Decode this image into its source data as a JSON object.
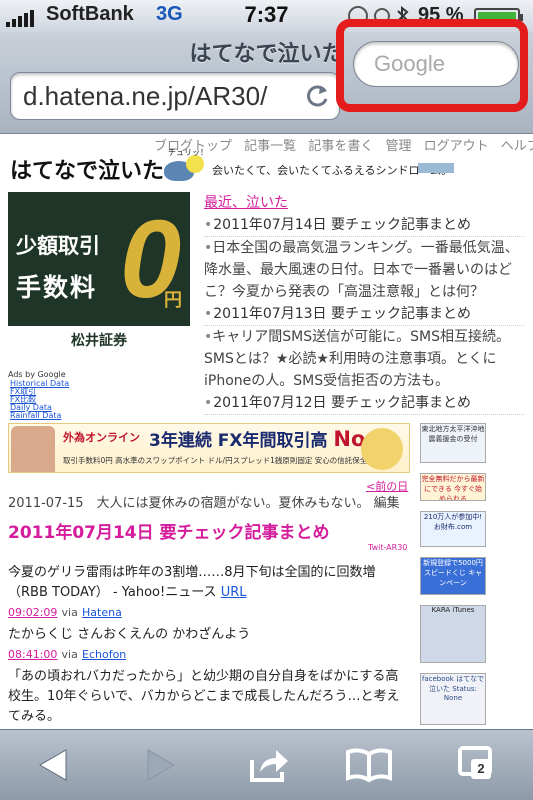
{
  "status_bar": {
    "carrier": "SoftBank",
    "network": "3G",
    "time": "7:37",
    "battery_percent": "95 %"
  },
  "browser": {
    "page_title": "はてなで泣いた",
    "url": "d.hatena.ne.jp/AR30/",
    "search_placeholder": "Google",
    "tab_count": "2"
  },
  "page": {
    "nav_links": [
      "ブログトップ",
      "記事一覧",
      "記事を書く",
      "管理",
      "ログアウト",
      "ヘルプ"
    ],
    "bird_tag": "チュリッ！",
    "blog_title": "はてなで泣いた",
    "tagline": "会いたくて、会いたくてふるえるシンドローム。",
    "ad_top": {
      "line1": "少額取引",
      "line2": "手数料",
      "zero": "0",
      "yen": "円",
      "brand": "松井証券"
    },
    "ads_by": "Ads by Google",
    "ad_links": [
      "Historical Data",
      "FX取引",
      "FX比較",
      "Daily Data",
      "Rainfall Data"
    ],
    "recent_heading": "最近、泣いた",
    "recent_items": [
      {
        "title": "2011年07月14日 要チェック記事まとめ",
        "summary": "日本全国の最高気温ランキング。一番最低気温、降水量、最大風速の日付。日本で一番暑いのはどこ？今夏から発表の「高温注意報」とは何？"
      },
      {
        "title": "2011年07月13日 要チェック記事まとめ",
        "summary": "キャリア間SMS送信が可能に。SMS相互接続。SMSとは？★必読★利用時の注意事項。とくにiPhoneの人。SMS受信拒否の方法も。"
      },
      {
        "title": "2011年07月12日 要チェック記事まとめ",
        "summary": ""
      }
    ],
    "ad_banner": {
      "logo": "外為オンライン",
      "headline_prefix": "3年連続 FX年間取引高",
      "headline_no1": "No.1",
      "sub": "取引手数料0円 高水準のスワップポイント ドル/円スプレッド1銭原則固定 安心の信託保全"
    },
    "side_ads": [
      "東北地方太平洋沖地震義援金の受付",
      "完全無料だから最新にできる 今すぐ始められる",
      "210万人が参加中!お財布.com",
      "新規登録で5000円 スピードくじ キャンペーン",
      "KARA iTunes",
      "facebook はてなで泣いた Status: None"
    ],
    "prev_link": "<前の日",
    "post_meta": "2011-07-15　大人には夏休みの宿題がない。夏休みもない。 編集",
    "post_title": "2011年07月14日 要チェック記事まとめ",
    "twit_label": "Twit-AR30",
    "entries": [
      {
        "text": "今夏のゲリラ雷雨は昨年の3割増……8月下旬は全国的に回数増（RBB TODAY） - Yahoo!ニュース ",
        "link": "URL",
        "time": "09:02:09",
        "via": "via",
        "source": "Hatena"
      },
      {
        "text": "たからくじ さんおくえんの かわざんよう",
        "link": "",
        "time": "08:41:00",
        "via": "via",
        "source": "Echofon"
      },
      {
        "text": "「あの頃おれバカだったから」と幼少期の自分自身をばかにする高校生。10年ぐらいで、バカからどこまで成長したんだろう…と考えてみる。",
        "link": "",
        "time": "",
        "via": "",
        "source": ""
      }
    ]
  }
}
